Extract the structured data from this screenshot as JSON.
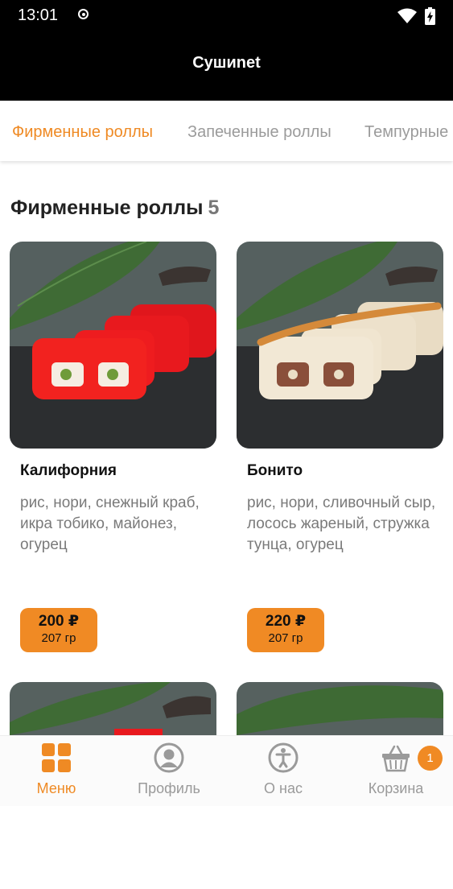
{
  "status_bar": {
    "time": "13:01"
  },
  "app_bar": {
    "title": "Сушиnet"
  },
  "tabs": [
    {
      "label": "Фирменные роллы",
      "active": true
    },
    {
      "label": "Запеченные роллы",
      "active": false
    },
    {
      "label": "Темпурные роллы",
      "active": false
    }
  ],
  "section": {
    "title": "Фирменные роллы",
    "count": "5"
  },
  "products": [
    {
      "name": "Калифорния",
      "description": "рис, нори, снежный краб, икра тобико, майонез, огурец",
      "price": "200 ₽",
      "weight": "207 гр"
    },
    {
      "name": "Бонито",
      "description": "рис, нори, сливочный сыр, лосось жареный, стружка тунца, огурец",
      "price": "220 ₽",
      "weight": "207 гр"
    }
  ],
  "bottom_nav": [
    {
      "label": "Меню",
      "icon": "grid-icon",
      "active": true
    },
    {
      "label": "Профиль",
      "icon": "profile-icon",
      "active": false
    },
    {
      "label": "О нас",
      "icon": "info-icon",
      "active": false
    },
    {
      "label": "Корзина",
      "icon": "basket-icon",
      "active": false
    }
  ],
  "cart_badge": "1",
  "colors": {
    "accent": "#f08a24",
    "app_bar": "#000000",
    "muted_text": "#9b9b9b"
  }
}
